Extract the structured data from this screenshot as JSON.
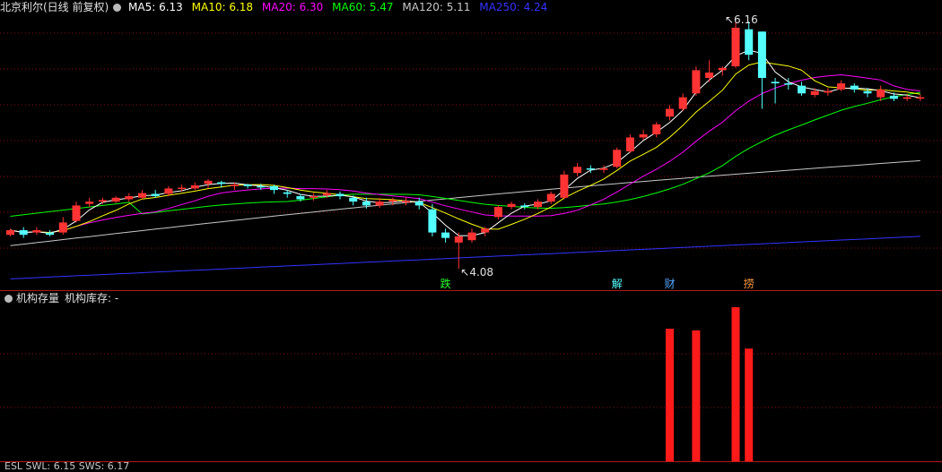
{
  "header": {
    "stock_name": "北京利尔(日线 前复权)",
    "ma5_label": "MA5: 6.13",
    "ma10_label": "MA10: 6.18",
    "ma20_label": "MA20: 6.30",
    "ma60_label": "MA60: 5.47",
    "ma120_label": "MA120: 5.11",
    "ma250_label": "MA250: 4.24"
  },
  "sub_header": {
    "indicator_name": "机构存量",
    "indicator_value": "机构库存: -"
  },
  "bottom_header": {
    "text": "ESL  SWL: 6.15  SWS: 6.17"
  },
  "colors": {
    "up": "#ff3333",
    "down": "#54ffff",
    "ma5": "#ffffff",
    "ma10": "#ffff00",
    "ma20": "#ff00ff",
    "ma60": "#00ff00",
    "ma120": "#c8c8c8",
    "ma250": "#3333ff",
    "grid": "#8b1010",
    "bar": "#ff1a1a"
  },
  "chart_data": {
    "type": "candlestick",
    "price_range": [
      3.85,
      7.35
    ],
    "annotations": {
      "high_label": "6.16",
      "low_label": "4.08"
    },
    "signal_labels": [
      {
        "text": "跌",
        "candle": 33,
        "color": "#2aff2a"
      },
      {
        "text": "解",
        "candle": 46,
        "color": "#54ffff"
      },
      {
        "text": "财",
        "candle": 50,
        "color": "#54a8ff"
      },
      {
        "text": "捞",
        "candle": 56,
        "color": "#ff9a40"
      }
    ],
    "candles": [
      [
        4.52,
        4.58,
        4.6,
        4.5
      ],
      [
        4.58,
        4.52,
        4.62,
        4.48
      ],
      [
        4.55,
        4.58,
        4.62,
        4.52
      ],
      [
        4.55,
        4.52,
        4.58,
        4.5
      ],
      [
        4.55,
        4.68,
        4.75,
        4.52
      ],
      [
        4.7,
        4.9,
        4.95,
        4.68
      ],
      [
        4.92,
        4.95,
        5.0,
        4.88
      ],
      [
        4.95,
        4.97,
        5.0,
        4.92
      ],
      [
        4.95,
        5.0,
        5.02,
        4.93
      ],
      [
        4.98,
        5.02,
        5.06,
        4.95
      ],
      [
        5.0,
        5.06,
        5.1,
        4.98
      ],
      [
        5.05,
        5.02,
        5.1,
        5.0
      ],
      [
        5.05,
        5.12,
        5.15,
        5.02
      ],
      [
        5.12,
        5.13,
        5.17,
        5.08
      ],
      [
        5.12,
        5.16,
        5.2,
        5.1
      ],
      [
        5.18,
        5.22,
        5.24,
        5.12
      ],
      [
        5.2,
        5.18,
        5.22,
        5.13
      ],
      [
        5.15,
        5.17,
        5.2,
        5.1
      ],
      [
        5.17,
        5.15,
        5.18,
        5.12
      ],
      [
        5.15,
        5.14,
        5.18,
        5.1
      ],
      [
        5.15,
        5.1,
        5.17,
        5.05
      ],
      [
        5.07,
        5.05,
        5.1,
        5.0
      ],
      [
        5.02,
        4.98,
        5.05,
        4.95
      ],
      [
        5.0,
        5.02,
        5.06,
        4.96
      ],
      [
        5.03,
        5.06,
        5.1,
        5.0
      ],
      [
        5.05,
        5.02,
        5.08,
        4.98
      ],
      [
        5.0,
        4.95,
        5.03,
        4.9
      ],
      [
        4.95,
        4.9,
        5.0,
        4.86
      ],
      [
        4.9,
        4.95,
        5.0,
        4.87
      ],
      [
        4.95,
        4.97,
        5.0,
        4.9
      ],
      [
        4.94,
        4.96,
        5.0,
        4.9
      ],
      [
        4.95,
        4.9,
        5.0,
        4.85
      ],
      [
        4.85,
        4.55,
        4.92,
        4.5
      ],
      [
        4.55,
        4.48,
        4.6,
        4.42
      ],
      [
        4.42,
        4.5,
        4.55,
        4.08
      ],
      [
        4.45,
        4.55,
        4.6,
        4.42
      ],
      [
        4.55,
        4.6,
        4.62,
        4.5
      ],
      [
        4.75,
        4.88,
        4.9,
        4.72
      ],
      [
        4.88,
        4.92,
        4.95,
        4.85
      ],
      [
        4.9,
        4.88,
        4.93,
        4.85
      ],
      [
        4.88,
        4.95,
        4.98,
        4.85
      ],
      [
        4.95,
        5.05,
        5.08,
        4.92
      ],
      [
        5.0,
        5.3,
        5.35,
        4.98
      ],
      [
        5.32,
        5.4,
        5.45,
        5.28
      ],
      [
        5.38,
        5.37,
        5.42,
        5.32
      ],
      [
        5.36,
        5.38,
        5.42,
        5.32
      ],
      [
        5.4,
        5.62,
        5.65,
        5.38
      ],
      [
        5.6,
        5.78,
        5.82,
        5.58
      ],
      [
        5.78,
        5.82,
        5.88,
        5.75
      ],
      [
        5.82,
        5.95,
        5.98,
        5.78
      ],
      [
        6.05,
        6.15,
        6.2,
        6.0
      ],
      [
        6.15,
        6.3,
        6.35,
        6.12
      ],
      [
        6.35,
        6.65,
        6.7,
        6.32
      ],
      [
        6.55,
        6.62,
        6.78,
        6.5
      ],
      [
        6.65,
        6.68,
        6.7,
        6.58
      ],
      [
        6.7,
        7.2,
        7.28,
        6.68
      ],
      [
        7.18,
        6.85,
        7.28,
        6.78
      ],
      [
        7.15,
        6.55,
        7.15,
        6.15
      ],
      [
        6.5,
        6.48,
        6.55,
        6.22
      ],
      [
        6.48,
        6.47,
        6.55,
        6.4
      ],
      [
        6.45,
        6.35,
        6.5,
        6.32
      ],
      [
        6.33,
        6.38,
        6.42,
        6.3
      ],
      [
        6.36,
        6.38,
        6.42,
        6.32
      ],
      [
        6.4,
        6.48,
        6.52,
        6.38
      ],
      [
        6.45,
        6.4,
        6.48,
        6.36
      ],
      [
        6.38,
        6.35,
        6.42,
        6.3
      ],
      [
        6.3,
        6.4,
        6.45,
        6.25
      ],
      [
        6.32,
        6.28,
        6.36,
        6.25
      ],
      [
        6.28,
        6.3,
        6.34,
        6.25
      ],
      [
        6.3,
        6.3,
        6.33,
        6.25
      ]
    ],
    "institution_bars": [
      {
        "candle": 50,
        "value": 0.8
      },
      {
        "candle": 52,
        "value": 0.79
      },
      {
        "candle": 55,
        "value": 0.93
      },
      {
        "candle": 56,
        "value": 0.68
      }
    ]
  }
}
